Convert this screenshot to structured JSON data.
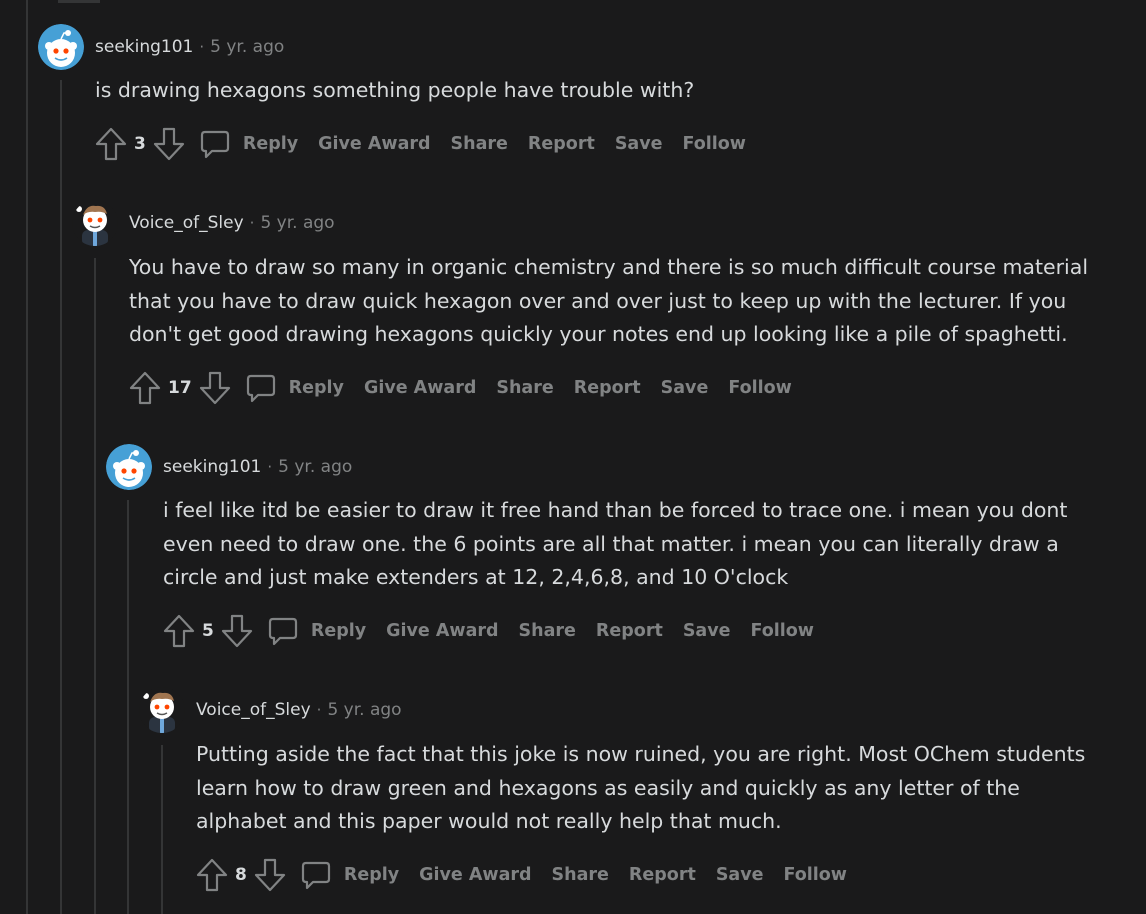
{
  "colors": {
    "background": "#1a1a1b",
    "text": "#d7dadc",
    "muted": "#818384",
    "thread_line": "#343536",
    "snoo_blue": "#46a0d6"
  },
  "separator": "·",
  "comments": [
    {
      "username": "seeking101",
      "timestamp": "5 yr. ago",
      "avatar": "snoo-blue-avatar",
      "lines": [
        "is drawing hexagons something people have trouble with?"
      ],
      "votes": "3",
      "actions": {
        "reply": "Reply",
        "award": "Give Award",
        "share": "Share",
        "report": "Report",
        "save": "Save",
        "follow": "Follow"
      }
    },
    {
      "username": "Voice_of_Sley",
      "timestamp": "5 yr. ago",
      "avatar": "snoo-custom-avatar",
      "lines": [
        "You have to draw so many in organic chemistry and there is so much difficult course material",
        "that you have to draw quick hexagon over and over just to keep up with the lecturer. If you",
        "don't get good drawing hexagons quickly your notes end up looking like a pile of spaghetti."
      ],
      "votes": "17",
      "actions": {
        "reply": "Reply",
        "award": "Give Award",
        "share": "Share",
        "report": "Report",
        "save": "Save",
        "follow": "Follow"
      }
    },
    {
      "username": "seeking101",
      "timestamp": "5 yr. ago",
      "avatar": "snoo-blue-avatar",
      "lines": [
        "i feel like itd be easier to draw it free hand than be forced to trace one. i mean you dont",
        "even need to draw one. the 6 points are all that matter. i mean you can literally draw a",
        "circle and just make extenders at 12, 2,4,6,8, and 10 O'clock"
      ],
      "votes": "5",
      "actions": {
        "reply": "Reply",
        "award": "Give Award",
        "share": "Share",
        "report": "Report",
        "save": "Save",
        "follow": "Follow"
      }
    },
    {
      "username": "Voice_of_Sley",
      "timestamp": "5 yr. ago",
      "avatar": "snoo-custom-avatar",
      "lines": [
        "Putting aside the fact that this joke is now ruined, you are right. Most OChem students",
        "learn how to draw green and hexagons as easily and quickly as any letter of the",
        "alphabet and this paper would not really help that much."
      ],
      "votes": "8",
      "actions": {
        "reply": "Reply",
        "award": "Give Award",
        "share": "Share",
        "report": "Report",
        "save": "Save",
        "follow": "Follow"
      }
    }
  ]
}
